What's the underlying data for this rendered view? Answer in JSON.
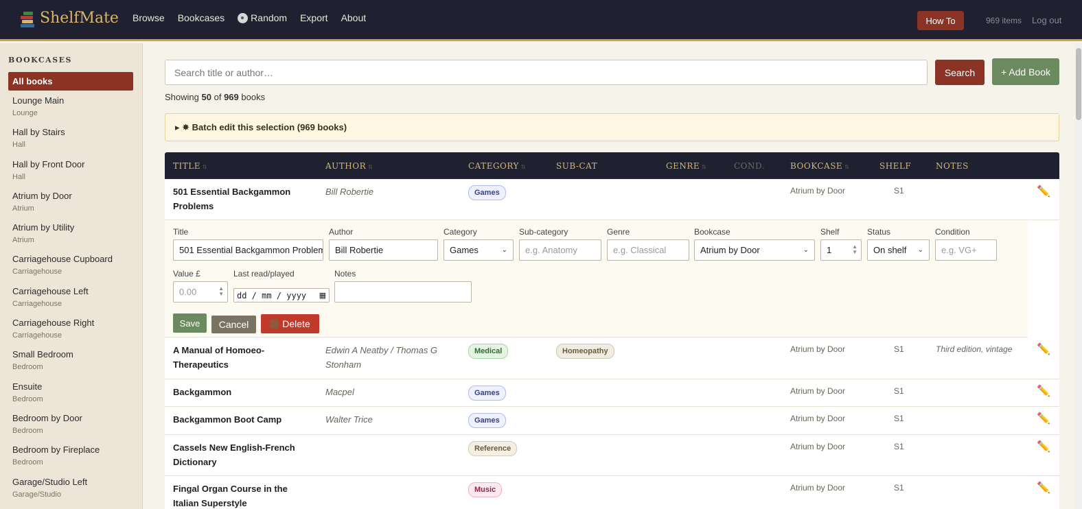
{
  "app": {
    "name": "ShelfMate"
  },
  "nav": {
    "browse": "Browse",
    "bookcases": "Bookcases",
    "random": "Random",
    "export": "Export",
    "about": "About"
  },
  "header": {
    "howto": "How To",
    "items": "969 items",
    "logout": "Log out"
  },
  "sidebar": {
    "heading": "BOOKCASES",
    "all": "All books",
    "items": [
      {
        "name": "Lounge Main",
        "room": "Lounge"
      },
      {
        "name": "Hall by Stairs",
        "room": "Hall"
      },
      {
        "name": "Hall by Front Door",
        "room": "Hall"
      },
      {
        "name": "Atrium by Door",
        "room": "Atrium"
      },
      {
        "name": "Atrium by Utility",
        "room": "Atrium"
      },
      {
        "name": "Carriagehouse Cupboard",
        "room": "Carriagehouse"
      },
      {
        "name": "Carriagehouse Left",
        "room": "Carriagehouse"
      },
      {
        "name": "Carriagehouse Right",
        "room": "Carriagehouse"
      },
      {
        "name": "Small Bedroom",
        "room": "Bedroom"
      },
      {
        "name": "Ensuite",
        "room": "Bedroom"
      },
      {
        "name": "Bedroom by Door",
        "room": "Bedroom"
      },
      {
        "name": "Bedroom by Fireplace",
        "room": "Bedroom"
      },
      {
        "name": "Garage/Studio Left",
        "room": "Garage/Studio"
      }
    ]
  },
  "search": {
    "placeholder": "Search title or author…",
    "button": "Search",
    "add": "+ Add Book"
  },
  "summary": {
    "prefix": "Showing",
    "shown": "50",
    "of": "of",
    "total": "969",
    "suffix": "books"
  },
  "batch": {
    "label": "▸ ✸ Batch edit this selection (969 books)"
  },
  "table": {
    "headers": {
      "title": "TITLE",
      "author": "AUTHOR",
      "category": "CATEGORY",
      "subcat": "SUB-CAT",
      "genre": "GENRE",
      "cond": "COND.",
      "bookcase": "BOOKCASE",
      "shelf": "SHELF",
      "notes": "NOTES"
    },
    "sort_glyph": "⇅",
    "rows": [
      {
        "title": "501 Essential Backgammon Problems",
        "author": "Bill Robertie",
        "category": "Games",
        "subcat": "",
        "bookcase": "Atrium by Door",
        "shelf": "S1",
        "notes": ""
      },
      {
        "title": "A Manual of Homoeo-Therapeutics",
        "author": "Edwin A Neatby / Thomas G Stonham",
        "category": "Medical",
        "subcat": "Homeopathy",
        "bookcase": "Atrium by Door",
        "shelf": "S1",
        "notes": "Third edition, vintage"
      },
      {
        "title": "Backgammon",
        "author": "Macpel",
        "category": "Games",
        "subcat": "",
        "bookcase": "Atrium by Door",
        "shelf": "S1",
        "notes": ""
      },
      {
        "title": "Backgammon Boot Camp",
        "author": "Walter Trice",
        "category": "Games",
        "subcat": "",
        "bookcase": "Atrium by Door",
        "shelf": "S1",
        "notes": ""
      },
      {
        "title": "Cassels New English-French Dictionary",
        "author": "",
        "category": "Reference",
        "subcat": "",
        "bookcase": "Atrium by Door",
        "shelf": "S1",
        "notes": ""
      },
      {
        "title": "Fingal Organ Course in the Italian Superstyle",
        "author": "",
        "category": "Music",
        "subcat": "",
        "bookcase": "Atrium by Door",
        "shelf": "S1",
        "notes": ""
      }
    ]
  },
  "edit_form": {
    "labels": {
      "title": "Title",
      "author": "Author",
      "category": "Category",
      "subcat": "Sub-category",
      "genre": "Genre",
      "bookcase": "Bookcase",
      "shelf": "Shelf",
      "status": "Status",
      "condition": "Condition",
      "value": "Value £",
      "last_read": "Last read/played",
      "notes": "Notes"
    },
    "values": {
      "title": "501 Essential Backgammon Problem",
      "author": "Bill Robertie",
      "category": "Games",
      "bookcase": "Atrium by Door",
      "shelf": "1",
      "status": "On shelf"
    },
    "placeholders": {
      "subcat": "e.g. Anatomy",
      "genre": "e.g. Classical",
      "condition": "e.g. VG+",
      "value": "0.00",
      "date": "dd / mm / yyyy"
    },
    "buttons": {
      "save": "Save",
      "cancel": "Cancel",
      "delete": "Delete"
    }
  },
  "icons": {
    "edit": "pencil-icon",
    "delete": "trash-icon",
    "random": "dice-icon",
    "logo": "books-icon"
  },
  "colors": {
    "accent": "#8b3325",
    "nav_bg": "#1f2030",
    "gold": "#d9b66b",
    "green": "#6b8a5f",
    "danger": "#c0392b"
  }
}
